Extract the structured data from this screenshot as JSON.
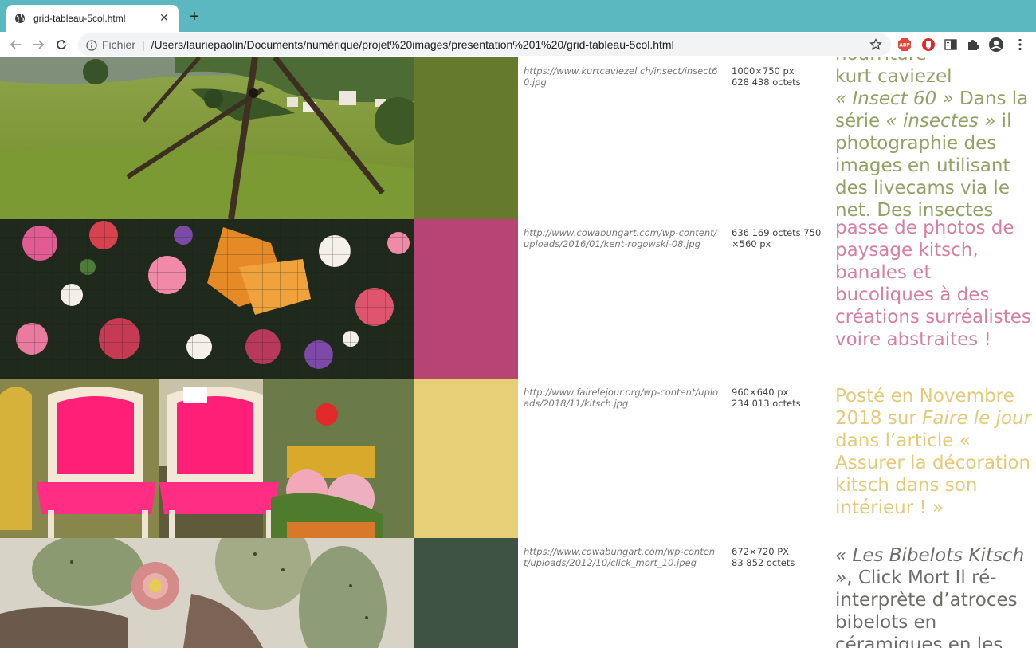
{
  "browser": {
    "tab_title": "grid-tableau-5col.html",
    "tab_close": "✕",
    "new_tab": "+",
    "scheme_label": "Fichier",
    "separator": "|",
    "url": "/Users/lauriepaolin/Documents/numérique/projet%20images/presentation%201%20/grid-tableau-5col.html",
    "extension_abp_label": "ABP"
  },
  "rows": [
    {
      "swatch_color": "#667a2e",
      "text_color": "#93a167",
      "url": "https://www.kurtcaviezel.ch/insect/insect60.jpg",
      "meta": "1000×750 px\n628 438 octets",
      "desc_top": "nourriture",
      "desc_author": "kurt caviezel",
      "desc_title": "« Insect 60 »",
      "desc_mid": " Dans la série ",
      "desc_series": "« insectes »",
      "desc_rest": " il photographie des images en utilisant des livecams via le net. Des insectes"
    },
    {
      "swatch_color": "#b84473",
      "text_color": "#d67fa0",
      "url": "http://www.cowabungart.com/wp-content/uploads/2016/01/kent-rogowski-08.jpg",
      "meta": "636 169 octets 750 ×560 px",
      "desc_text": "passe de photos de paysage kitsch, banales et bucoliques à des créations surréalistes voire abstraites !"
    },
    {
      "swatch_color": "#e6cf76",
      "text_color": "#e3ca7a",
      "url": "http://www.fairelejour.org/wp-content/uploads/2018/11/kitsch.jpg",
      "meta": "960×640 px\n234 013 octets",
      "desc_pre": "Posté en Novembre 2018 sur ",
      "desc_site": "Faire le jour",
      "desc_post": " dans l’article « Assurer la décoration kitsch dans son intérieur ! »"
    },
    {
      "swatch_color": "#3e5341",
      "text_color": "#6d6e69",
      "url": "https://www.cowabungart.com/wp-content/uploads/2012/10/click_mort_10.jpeg",
      "meta": "672×720 PX\n83 852 octets",
      "desc_title": "« Les Bibelots Kitsch »",
      "desc_rest": ", Click Mort Il ré-interprète d’atroces bibelots en céramiques en les"
    }
  ]
}
